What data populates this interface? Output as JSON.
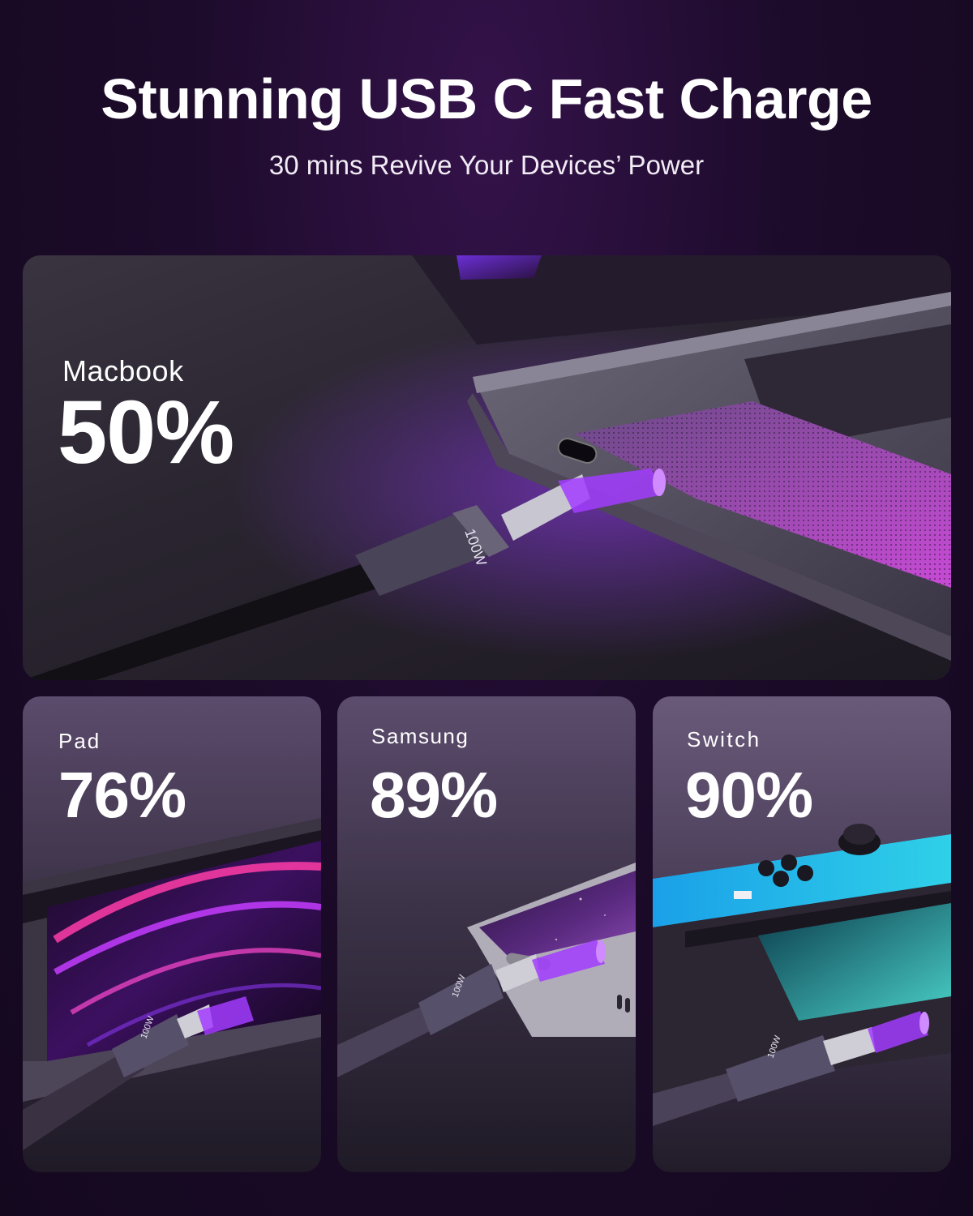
{
  "header": {
    "title": "Stunning USB C Fast Charge",
    "subtitle": "30 mins Revive Your Devices’ Power"
  },
  "cards": {
    "macbook": {
      "label": "Macbook",
      "percent": "50%"
    },
    "pad": {
      "label": "Pad",
      "percent": "76%"
    },
    "samsung": {
      "label": "Samsung",
      "percent": "89%"
    },
    "switch": {
      "label": "Switch",
      "percent": "90%"
    }
  },
  "cable": {
    "marking": "100W"
  },
  "colors": {
    "background": "#1c0b2a",
    "accent_purple": "#a23cff",
    "switch_blue": "#1aa0e8"
  }
}
